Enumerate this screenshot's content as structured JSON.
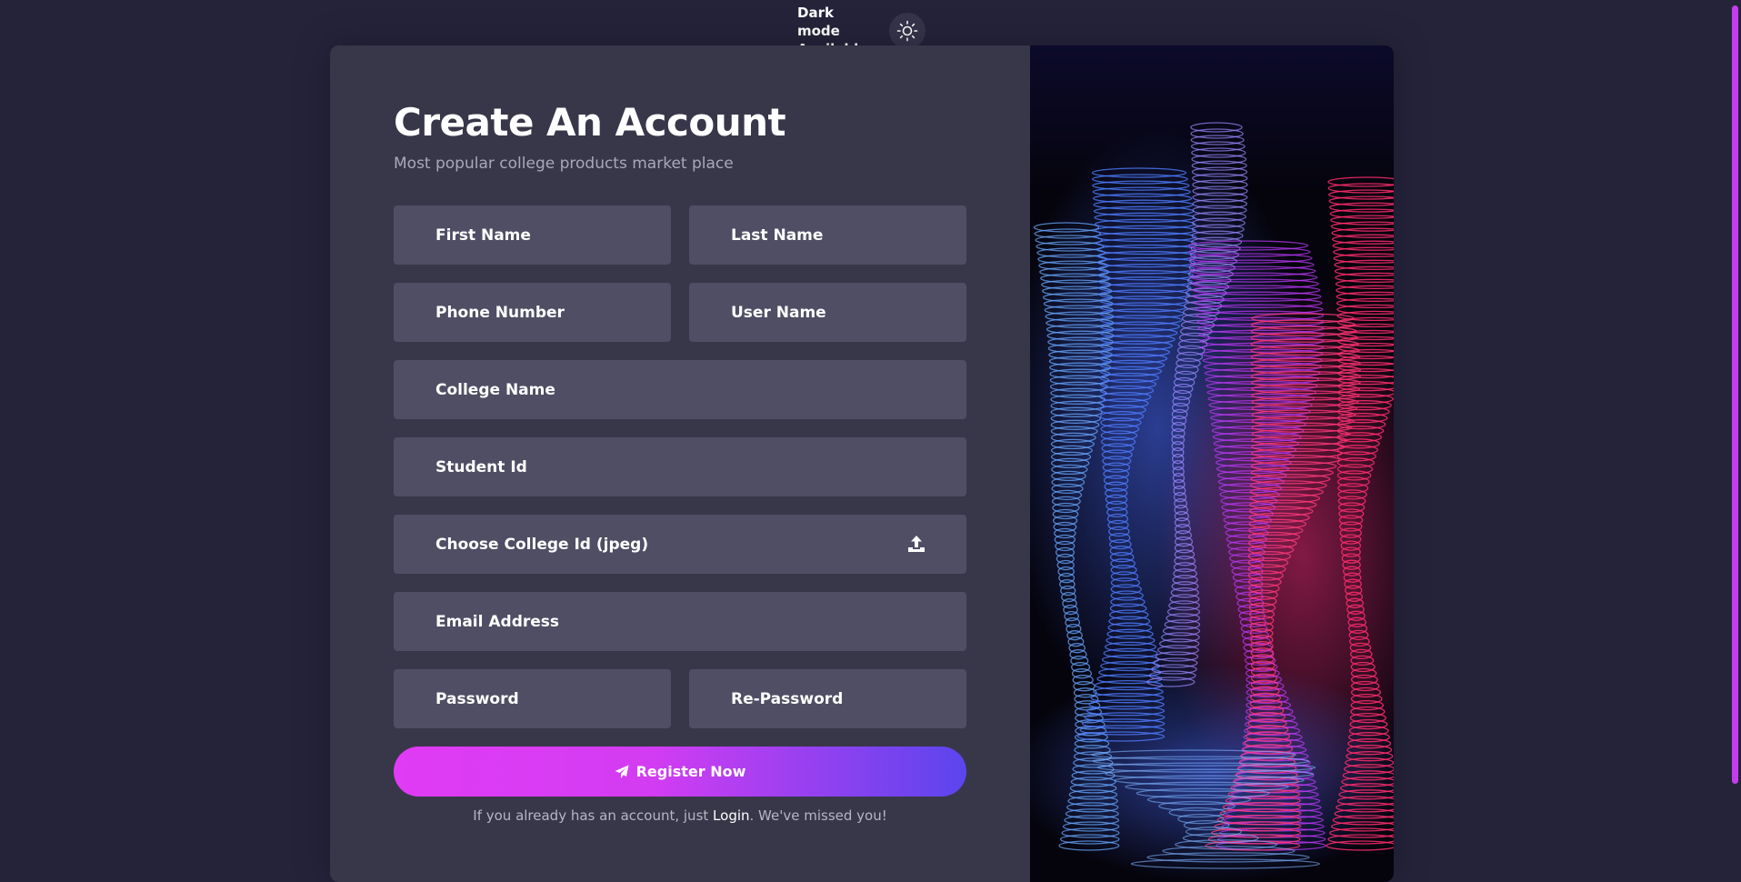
{
  "header": {
    "dark_mode_line1": "Dark mode",
    "dark_mode_line2": "Available",
    "toggle_icon": "sun-icon"
  },
  "form": {
    "title": "Create An Account",
    "subtitle": "Most popular college products market place",
    "fields": {
      "first_name": "First Name",
      "last_name": "Last Name",
      "phone_number": "Phone Number",
      "user_name": "User Name",
      "college_name": "College Name",
      "student_id": "Student Id",
      "college_id_file": "Choose College Id (jpeg)",
      "email": "Email Address",
      "password": "Password",
      "re_password": "Re-Password"
    },
    "register_label": "Register Now",
    "footer_prefix": "If you already has an account, just ",
    "footer_link": "Login",
    "footer_suffix": ". We've missed you!"
  },
  "colors": {
    "background": "#25233a",
    "card": "#383749",
    "field": "#4f4e64",
    "accent_start": "#e03bf5",
    "accent_end": "#5b45ee"
  }
}
